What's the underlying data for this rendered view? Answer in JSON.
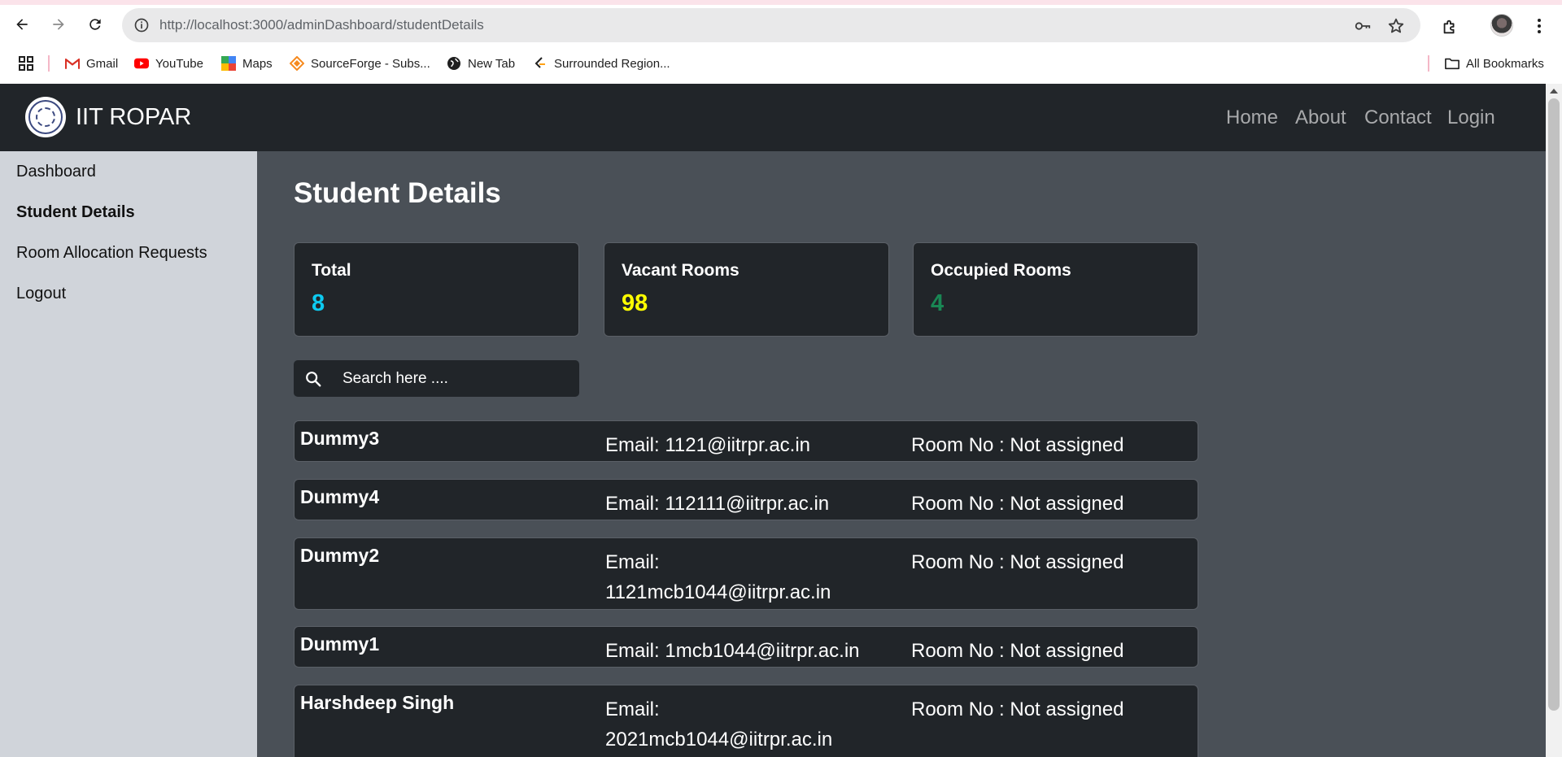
{
  "browser": {
    "url": "http://localhost:3000/adminDashboard/studentDetails",
    "bookmarks": [
      {
        "label": "Gmail",
        "icon": "gmail-icon"
      },
      {
        "label": "YouTube",
        "icon": "youtube-icon"
      },
      {
        "label": "Maps",
        "icon": "maps-icon"
      },
      {
        "label": "SourceForge - Subs...",
        "icon": "sourceforge-icon"
      },
      {
        "label": "New Tab",
        "icon": "globe-icon"
      },
      {
        "label": "Surrounded Region...",
        "icon": "leetcode-icon"
      }
    ],
    "all_bookmarks": "All Bookmarks"
  },
  "navbar": {
    "brand": "IIT ROPAR",
    "links": [
      "Home",
      "About",
      "Contact",
      "Login"
    ]
  },
  "sidebar": {
    "items": [
      {
        "label": "Dashboard",
        "active": false
      },
      {
        "label": "Student Details",
        "active": true
      },
      {
        "label": "Room Allocation Requests",
        "active": false
      },
      {
        "label": "Logout",
        "active": false
      }
    ]
  },
  "main": {
    "title": "Student Details",
    "cards": [
      {
        "label": "Total",
        "value": "8",
        "color": "#0dcaf0"
      },
      {
        "label": "Vacant Rooms",
        "value": "98",
        "color": "#ffff00"
      },
      {
        "label": "Occupied Rooms",
        "value": "4",
        "color": "#198754"
      }
    ],
    "search": {
      "placeholder": "Search here ...."
    },
    "students": [
      {
        "name": "Dummy3",
        "email": "Email: 1121@iitrpr.ac.in",
        "room": "Room No : Not assigned"
      },
      {
        "name": "Dummy4",
        "email": "Email: 112111@iitrpr.ac.in",
        "room": "Room No : Not assigned"
      },
      {
        "name": "Dummy2",
        "email": "Email: 1121mcb1044@iitrpr.ac.in",
        "room": "Room No : Not assigned"
      },
      {
        "name": "Dummy1",
        "email": "Email: 1mcb1044@iitrpr.ac.in",
        "room": "Room No : Not assigned"
      },
      {
        "name": "Harshdeep Singh",
        "email": "Email: 2021mcb1044@iitrpr.ac.in",
        "room": "Room No : Not assigned"
      }
    ]
  },
  "colors": {
    "navbar_bg": "#212529",
    "sidebar_bg": "#d0d4da",
    "main_bg": "#4a5057",
    "card_bg": "#212529"
  }
}
